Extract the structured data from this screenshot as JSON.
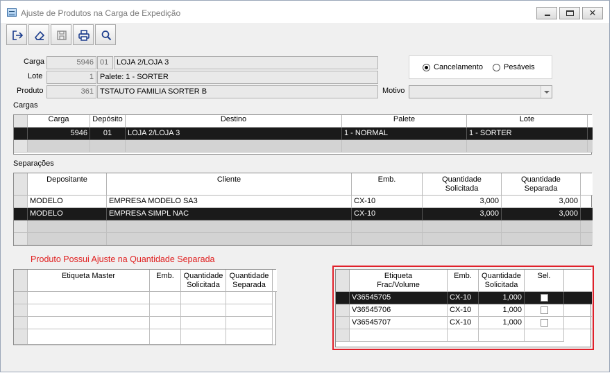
{
  "window": {
    "title": "Ajuste de Produtos na Carga de Expedição",
    "close_glyph": "✕"
  },
  "toolbar": {
    "buttons": [
      "exit-icon",
      "eraser-icon",
      "save-icon",
      "print-icon",
      "search-icon"
    ]
  },
  "form": {
    "carga": {
      "label": "Carga",
      "number": "5946",
      "deposit": "01",
      "name": "LOJA 2/LOJA 3"
    },
    "lote": {
      "label": "Lote",
      "number": "1",
      "desc": "Palete: 1 - SORTER"
    },
    "produto": {
      "label": "Produto",
      "number": "361",
      "desc": "TSTAUTO FAMILIA SORTER B"
    },
    "motivo": {
      "label": "Motivo",
      "value": ""
    }
  },
  "options": {
    "cancelamento": "Cancelamento",
    "pesaveis": "Pesáveis",
    "selected": "cancelamento"
  },
  "cargas": {
    "section_label": "Cargas",
    "headers": [
      "Carga",
      "Depósito",
      "Destino",
      "Palete",
      "Lote"
    ],
    "rows": [
      [
        "5946",
        "01",
        "LOJA 2/LOJA 3",
        "1 - NORMAL",
        "1 - SORTER"
      ]
    ]
  },
  "separacoes": {
    "section_label": "Separações",
    "headers": [
      "Depositante",
      "Cliente",
      "Emb.",
      "Quantidade\nSolicitada",
      "Quantidade\nSeparada"
    ],
    "rows": [
      [
        "MODELO",
        "EMPRESA MODELO SA3",
        "CX-10",
        "3,000",
        "3,000"
      ],
      [
        "MODELO",
        "EMPRESA SIMPL NAC",
        "CX-10",
        "3,000",
        "3,000"
      ]
    ]
  },
  "warning": "Produto Possui Ajuste na Quantidade Separada",
  "etiqueta_master": {
    "headers": [
      "Etiqueta Master",
      "Emb.",
      "Quantidade\nSolicitada",
      "Quantidade\nSeparada"
    ]
  },
  "etiqueta_frac": {
    "headers": [
      "Etiqueta\nFrac/Volume",
      "Emb.",
      "Quantidade\nSolicitada",
      "Sel."
    ],
    "rows": [
      [
        "V36545705",
        "CX-10",
        "1,000"
      ],
      [
        "V36545706",
        "CX-10",
        "1,000"
      ],
      [
        "V36545707",
        "CX-10",
        "1,000"
      ]
    ]
  }
}
